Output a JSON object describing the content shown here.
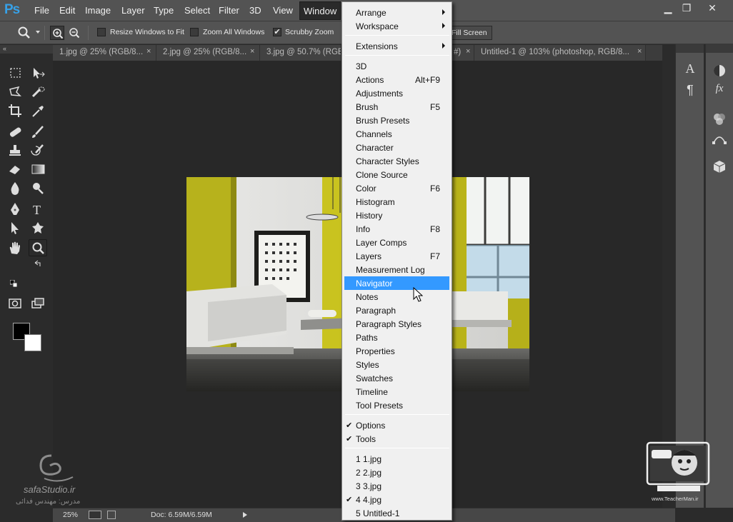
{
  "app": {
    "logo": "Ps"
  },
  "menubar": {
    "items": [
      "File",
      "Edit",
      "Image",
      "Layer",
      "Type",
      "Select",
      "Filter",
      "3D",
      "View",
      "Window"
    ],
    "active": "Window"
  },
  "window_controls": {
    "minimize": "▁",
    "restore": "❐",
    "close": "✕"
  },
  "options": {
    "resize_windows_to_fit": {
      "label": "Resize Windows to Fit",
      "checked": false
    },
    "zoom_all_windows": {
      "label": "Zoom All Windows",
      "checked": false
    },
    "scrubby_zoom": {
      "label": "Scrubby Zoom",
      "checked": true
    },
    "fill_screen": "Fill Screen"
  },
  "tabs": [
    {
      "label": "1.jpg @ 25% (RGB/8...",
      "close": "×"
    },
    {
      "label": "2.jpg @ 25% (RGB/8...",
      "close": "×"
    },
    {
      "label": "3.jpg @ 50.7% (RGB/8",
      "close": ""
    },
    {
      "label": "#)",
      "close": "×"
    },
    {
      "label": "Untitled-1 @ 103% (photoshop, RGB/8...",
      "close": "×"
    }
  ],
  "window_menu": {
    "group1": [
      {
        "label": "Arrange",
        "submenu": true
      },
      {
        "label": "Workspace",
        "submenu": true
      }
    ],
    "group2": [
      {
        "label": "Extensions",
        "submenu": true
      }
    ],
    "group3": [
      {
        "label": "3D",
        "shortcut": ""
      },
      {
        "label": "Actions",
        "shortcut": "Alt+F9"
      },
      {
        "label": "Adjustments",
        "shortcut": ""
      },
      {
        "label": "Brush",
        "shortcut": "F5"
      },
      {
        "label": "Brush Presets",
        "shortcut": ""
      },
      {
        "label": "Channels",
        "shortcut": ""
      },
      {
        "label": "Character",
        "shortcut": ""
      },
      {
        "label": "Character Styles",
        "shortcut": ""
      },
      {
        "label": "Clone Source",
        "shortcut": ""
      },
      {
        "label": "Color",
        "shortcut": "F6"
      },
      {
        "label": "Histogram",
        "shortcut": ""
      },
      {
        "label": "History",
        "shortcut": ""
      },
      {
        "label": "Info",
        "shortcut": "F8"
      },
      {
        "label": "Layer Comps",
        "shortcut": ""
      },
      {
        "label": "Layers",
        "shortcut": "F7"
      },
      {
        "label": "Measurement Log",
        "shortcut": ""
      },
      {
        "label": "Navigator",
        "shortcut": "",
        "highlighted": true
      },
      {
        "label": "Notes",
        "shortcut": ""
      },
      {
        "label": "Paragraph",
        "shortcut": ""
      },
      {
        "label": "Paragraph Styles",
        "shortcut": ""
      },
      {
        "label": "Paths",
        "shortcut": ""
      },
      {
        "label": "Properties",
        "shortcut": ""
      },
      {
        "label": "Styles",
        "shortcut": ""
      },
      {
        "label": "Swatches",
        "shortcut": ""
      },
      {
        "label": "Timeline",
        "shortcut": ""
      },
      {
        "label": "Tool Presets",
        "shortcut": ""
      }
    ],
    "group4": [
      {
        "label": "Options",
        "checked": true
      },
      {
        "label": "Tools",
        "checked": true
      }
    ],
    "group5": [
      {
        "label": "1 1.jpg",
        "checked": false
      },
      {
        "label": "2 2.jpg",
        "checked": false
      },
      {
        "label": "3 3.jpg",
        "checked": false
      },
      {
        "label": "4 4.jpg",
        "checked": true
      },
      {
        "label": "5 Untitled-1",
        "checked": false
      }
    ]
  },
  "check_glyph": "✔",
  "right_panels": {
    "character_icon": "A",
    "paragraph_icon": "¶",
    "styles_icon": "fx"
  },
  "status": {
    "zoom": "25%",
    "doc": "Doc: 6.59M/6.59M"
  },
  "watermark": {
    "site": "safaStudio.ir",
    "credit": "مدرس: مهندس فدائی",
    "right_site": "www.TeacherMan.ir"
  },
  "colors": {
    "menu_bg": "#535353",
    "canvas_bg": "#282828",
    "highlight": "#3399ff",
    "logo": "#37a1e8"
  }
}
